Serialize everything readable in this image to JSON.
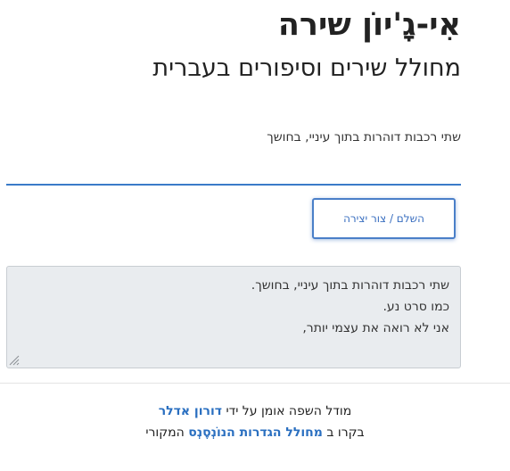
{
  "header": {
    "title": "אִי-גָ'יוֹן שירה",
    "subtitle": "מחולל שירים וסיפורים בעברית"
  },
  "prompt": {
    "label": "שתי רכבות דוהרות בתוך עיניי, בחושך",
    "value": ""
  },
  "actions": {
    "complete_label": "השלם / צור יצירה"
  },
  "output": {
    "lines": [
      "שתי רכבות דוהרות בתוך עיניי, בחושך.",
      "כמו סרט נע.",
      "אני לא רואה את עצמי יותר,"
    ]
  },
  "footer": {
    "line1_prefix": "מודל השפה אומן על ידי",
    "author_link": "דורון אדלר",
    "line2_prefix": "בקרו ב",
    "repo_link": "מחולל הגדרות הנוֹנְסֶנְס",
    "line2_suffix": "המקורי"
  },
  "colors": {
    "accent": "#3a7bc8",
    "link": "#2a6fc0",
    "output_bg": "#e9ecef"
  }
}
